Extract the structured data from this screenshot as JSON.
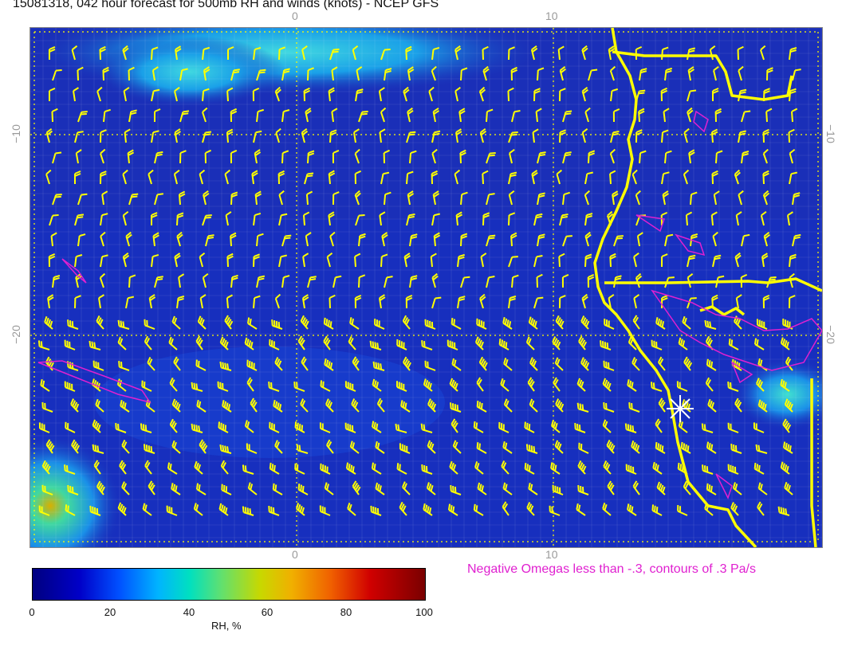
{
  "title": "15081318, 042 hour forecast for 500mb RH and winds (knots) - NCEP GFS",
  "axes": {
    "top": [
      "0",
      "10"
    ],
    "bottom": [
      "0",
      "10"
    ],
    "left": [
      "−10",
      "−20"
    ],
    "right": [
      "−10",
      "−20"
    ]
  },
  "omega_note": "Negative Omegas less than -.3, contours of .3 Pa/s",
  "colorbar": {
    "ticks": [
      "0",
      "20",
      "40",
      "60",
      "80",
      "100"
    ],
    "label": "RH, %",
    "colors": [
      "#000080",
      "#0000c8",
      "#0050ff",
      "#00b4ff",
      "#00e0c0",
      "#60e070",
      "#c8d800",
      "#f0b000",
      "#f06000",
      "#d00000",
      "#7a0000"
    ]
  },
  "colors": {
    "background": "#1a2fb8",
    "wind_barbs": "#ffff00",
    "coastline": "#ffff00",
    "omega_contours": "#e020d0",
    "grid_dotted": "#ffff00",
    "marker": "#ffffff"
  }
}
